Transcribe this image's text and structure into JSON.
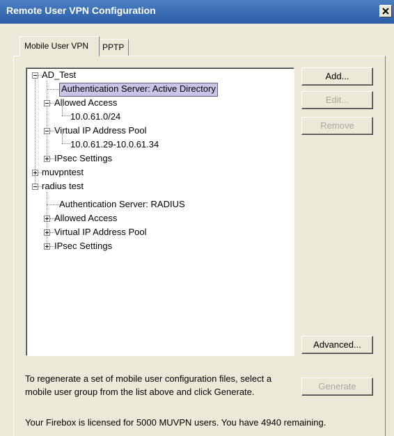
{
  "window": {
    "title": "Remote User VPN Configuration"
  },
  "tabs": [
    {
      "label": "Mobile User VPN",
      "active": true
    },
    {
      "label": "PPTP",
      "active": false
    }
  ],
  "tree": {
    "nodes": [
      {
        "label": "AD_Test",
        "expander": "minus"
      },
      {
        "label": "Authentication Server: Active Directory",
        "selected": true
      },
      {
        "label": "Allowed Access",
        "expander": "minus"
      },
      {
        "label": "10.0.61.0/24"
      },
      {
        "label": "Virtual IP Address Pool",
        "expander": "minus"
      },
      {
        "label": "10.0.61.29-10.0.61.34"
      },
      {
        "label": "IPsec Settings",
        "expander": "plus"
      },
      {
        "label": "muvpntest",
        "expander": "plus"
      },
      {
        "label": "radius test",
        "expander": "minus"
      },
      {
        "label": "Authentication Server: RADIUS"
      },
      {
        "label": "Allowed Access",
        "expander": "plus"
      },
      {
        "label": "Virtual IP Address Pool",
        "expander": "plus"
      },
      {
        "label": "IPsec Settings",
        "expander": "plus"
      }
    ]
  },
  "buttons": {
    "add": "Add...",
    "edit": "Edit...",
    "remove": "Remove",
    "advanced": "Advanced...",
    "generate": "Generate"
  },
  "info": {
    "regenerate_line1": "To regenerate a set of mobile user configuration files, select a",
    "regenerate_line2": "mobile user group from the list above and click Generate.",
    "license": "Your Firebox is licensed for 5000 MUVPN users. You have 4940 remaining."
  },
  "colors": {
    "titlebar": "#2a5ea9",
    "selection": "#C9C4E8",
    "dialog": "#ECE9D8"
  }
}
